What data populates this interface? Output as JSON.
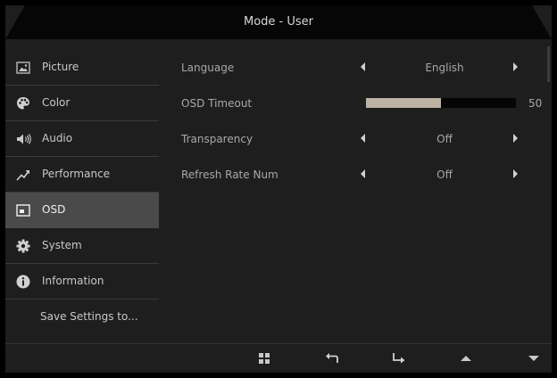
{
  "header": {
    "title": "Mode - User"
  },
  "sidebar": {
    "items": [
      {
        "label": "Picture",
        "icon": "picture-icon"
      },
      {
        "label": "Color",
        "icon": "palette-icon"
      },
      {
        "label": "Audio",
        "icon": "speaker-icon"
      },
      {
        "label": "Performance",
        "icon": "trend-icon"
      },
      {
        "label": "OSD",
        "icon": "osd-icon",
        "selected": true
      },
      {
        "label": "System",
        "icon": "gear-icon"
      },
      {
        "label": "Information",
        "icon": "info-icon"
      },
      {
        "label": "Save Settings to..."
      }
    ]
  },
  "settings": {
    "language": {
      "label": "Language",
      "value": "English"
    },
    "osd_timeout": {
      "label": "OSD Timeout",
      "value": "50",
      "level": 0.5
    },
    "transparency": {
      "label": "Transparency",
      "value": "Off"
    },
    "refresh_rate_num": {
      "label": "Refresh Rate Num",
      "value": "Off"
    }
  },
  "footer": {
    "buttons": [
      "menu-grid-icon",
      "back-icon",
      "enter-icon",
      "up-icon",
      "down-icon"
    ]
  },
  "colors": {
    "slider_fill": "#bdb3a4",
    "selected_bg": "#4a4a4a"
  }
}
